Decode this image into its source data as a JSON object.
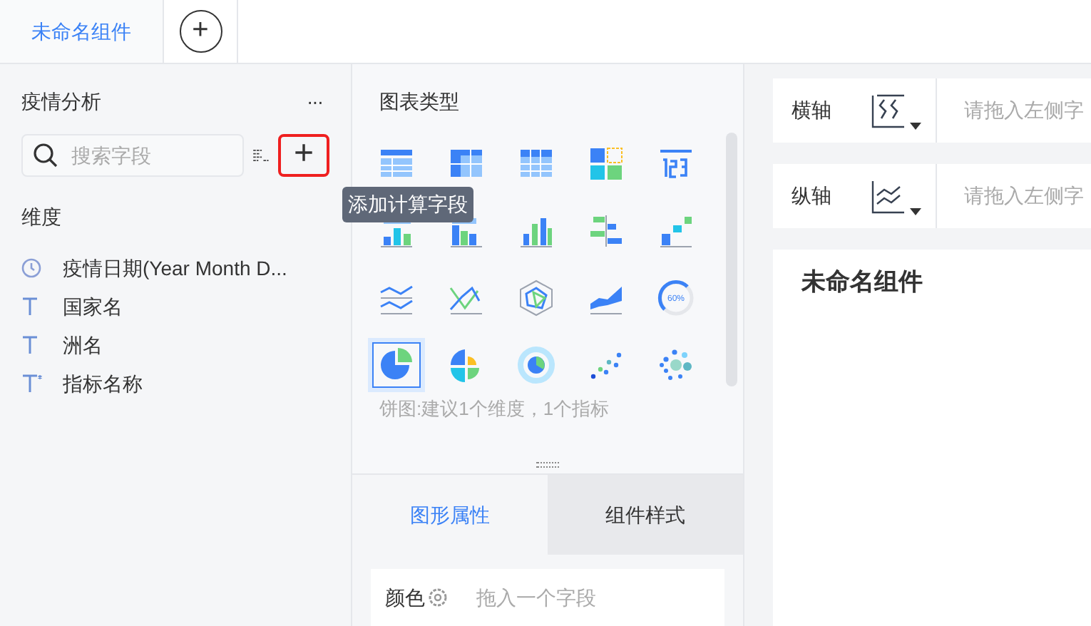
{
  "tabs": [
    {
      "label": "未命名组件",
      "selected": true
    }
  ],
  "add_tab_icon": "+",
  "data_panel": {
    "title": "疫情分析",
    "more": "···",
    "search": {
      "placeholder": "搜索字段"
    },
    "add_field_tooltip": "添加计算字段",
    "add_field_icon": "+",
    "section": "维度",
    "fields": [
      {
        "kind": "date",
        "label": "疫情日期(Year Month D..."
      },
      {
        "kind": "text",
        "label": "国家名"
      },
      {
        "kind": "text",
        "label": "洲名"
      },
      {
        "kind": "text-calc",
        "label": "指标名称"
      }
    ]
  },
  "chart_panel": {
    "title": "图表类型",
    "chart_types": [
      {
        "kind": "table",
        "selected": false
      },
      {
        "kind": "crosstab",
        "selected": false
      },
      {
        "kind": "grid",
        "selected": false
      },
      {
        "kind": "blocks",
        "selected": false
      },
      {
        "kind": "kpi",
        "selected": false
      },
      {
        "kind": "stacked-bar",
        "selected": false
      },
      {
        "kind": "grouped-bar",
        "selected": false
      },
      {
        "kind": "bar",
        "selected": false
      },
      {
        "kind": "diverging-bar",
        "selected": false
      },
      {
        "kind": "step-bar",
        "selected": false
      },
      {
        "kind": "lines",
        "selected": false
      },
      {
        "kind": "cross-line",
        "selected": false
      },
      {
        "kind": "radar",
        "selected": false
      },
      {
        "kind": "area",
        "selected": false
      },
      {
        "kind": "gauge",
        "label": "60%",
        "selected": false
      },
      {
        "kind": "pie",
        "selected": true
      },
      {
        "kind": "rose",
        "selected": false
      },
      {
        "kind": "sunburst",
        "selected": false
      },
      {
        "kind": "scatter",
        "selected": false
      },
      {
        "kind": "bubble",
        "selected": false
      }
    ],
    "hint": "饼图:建议1个维度，1个指标",
    "prop_tabs": [
      {
        "label": "图形属性",
        "selected": true
      },
      {
        "label": "组件样式",
        "selected": false
      }
    ],
    "color_row": {
      "label": "颜色",
      "placeholder": "拖入一个字段"
    }
  },
  "axes": [
    {
      "label": "横轴",
      "kind": "x",
      "placeholder": "请拖入左侧字"
    },
    {
      "label": "纵轴",
      "kind": "y",
      "placeholder": "请拖入左侧字"
    }
  ],
  "canvas": {
    "title": "未命名组件"
  }
}
